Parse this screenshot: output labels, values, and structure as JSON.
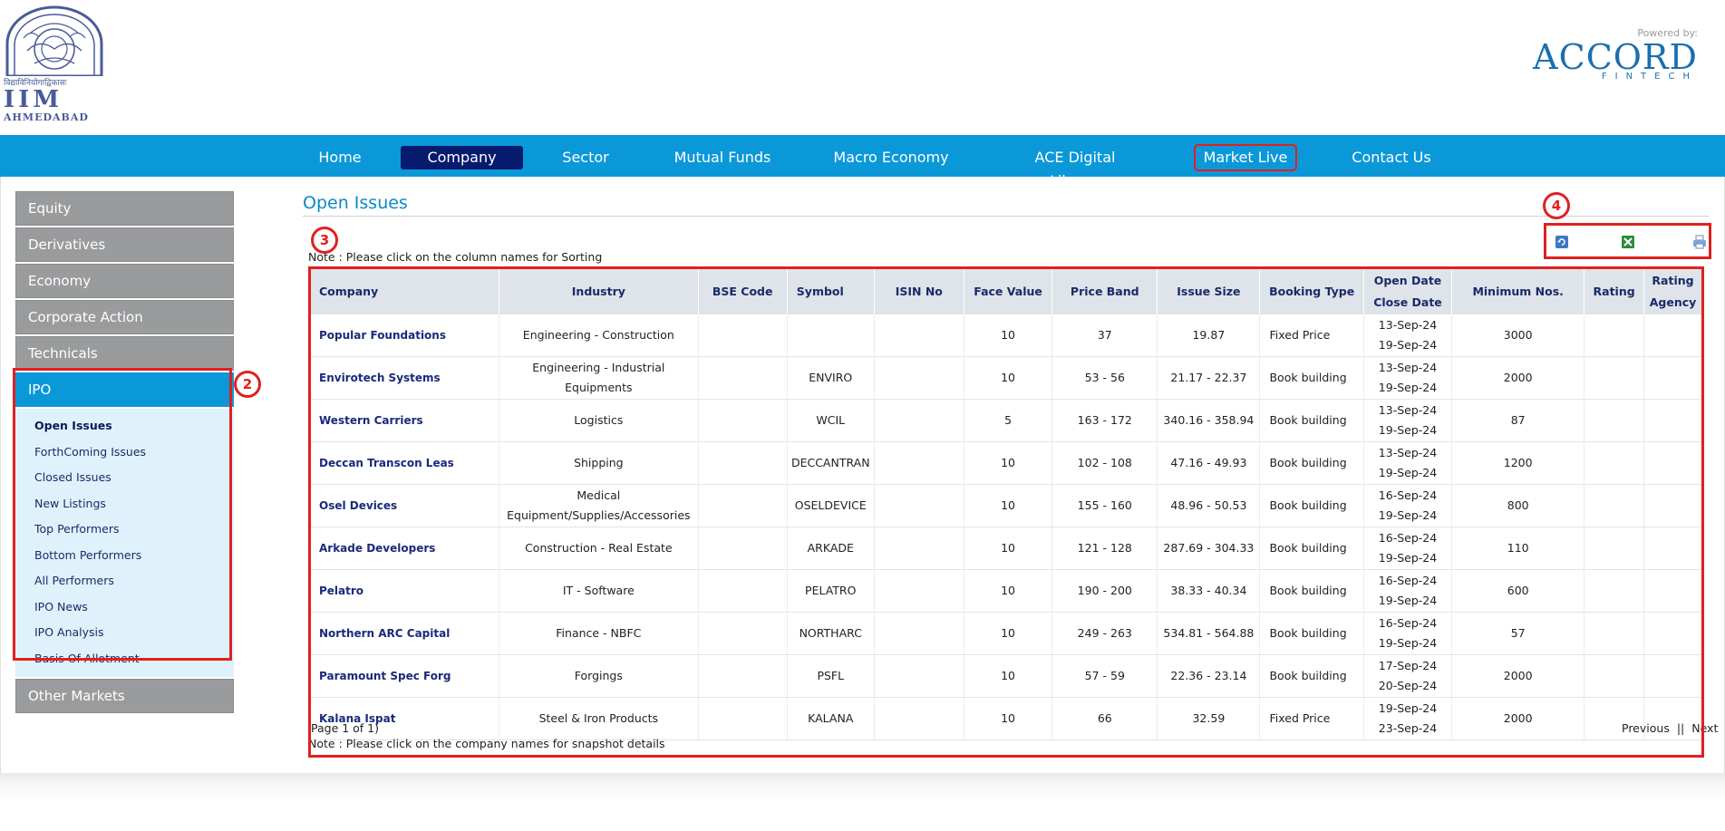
{
  "header": {
    "logo": {
      "hindi_line": "विद्याविनियोगाद्विकासः",
      "abbr": "IIM",
      "city": "AHMEDABAD"
    },
    "powered_by": {
      "label": "Powered by:",
      "brand": "ACCORD",
      "sub": "FINTECH"
    }
  },
  "nav": {
    "items": [
      {
        "label": "Home"
      },
      {
        "label": "Company"
      },
      {
        "label": "Sector"
      },
      {
        "label": "Mutual Funds"
      },
      {
        "label": "Macro Economy"
      },
      {
        "label": "ACE Digital Library"
      },
      {
        "label": "Market Live"
      },
      {
        "label": "Contact Us"
      }
    ],
    "active": "Company"
  },
  "sidebar": {
    "items": [
      {
        "label": "Equity"
      },
      {
        "label": "Derivatives"
      },
      {
        "label": "Economy"
      },
      {
        "label": "Corporate Action"
      },
      {
        "label": "Technicals"
      },
      {
        "label": "IPO"
      }
    ],
    "ipo_submenu": [
      {
        "label": "Open Issues"
      },
      {
        "label": "ForthComing Issues"
      },
      {
        "label": "Closed Issues"
      },
      {
        "label": "New Listings"
      },
      {
        "label": "Top Performers"
      },
      {
        "label": "Bottom Performers"
      },
      {
        "label": "All Performers"
      },
      {
        "label": "IPO News"
      },
      {
        "label": "IPO Analysis"
      },
      {
        "label": "Basis Of Allotment"
      }
    ],
    "after": {
      "label": "Other Markets"
    }
  },
  "markers": {
    "m2": "2",
    "m3": "3",
    "m4": "4"
  },
  "main": {
    "title": "Open Issues",
    "sort_note": "Note : Please click on the column names for Sorting",
    "snapshot_note": "Note : Please click on the company names for snapshot details",
    "page_info": "Page 1 of 1)",
    "pager": {
      "previous": "Previous",
      "separator": "||",
      "next": "Next"
    },
    "tools": [
      "refresh-icon",
      "excel-icon",
      "print-icon"
    ]
  },
  "table": {
    "headers": {
      "company": "Company",
      "industry": "Industry",
      "bse_code": "BSE Code",
      "symbol": "Symbol",
      "isin": "ISIN No",
      "face_value": "Face Value",
      "price_band": "Price Band",
      "issue_size": "Issue Size",
      "booking_type": "Booking Type",
      "open_date": "Open Date",
      "close_date": "Close Date",
      "minimum_nos": "Minimum Nos.",
      "rating": "Rating",
      "rating_agency_1": "Rating",
      "rating_agency_2": "Agency"
    },
    "rows": [
      {
        "company": "Popular Foundations",
        "industry": "Engineering - Construction",
        "bse_code": "",
        "symbol": "",
        "isin": "",
        "face_value": "10",
        "price_band": "37",
        "issue_size": "19.87",
        "booking_type": "Fixed Price",
        "open_date": "13-Sep-24",
        "close_date": "19-Sep-24",
        "minimum_nos": "3000",
        "rating": "",
        "rating_agency": ""
      },
      {
        "company": "Envirotech Systems",
        "industry": "Engineering - Industrial Equipments",
        "bse_code": "",
        "symbol": "ENVIRO",
        "isin": "",
        "face_value": "10",
        "price_band": "53 - 56",
        "issue_size": "21.17 - 22.37",
        "booking_type": "Book building",
        "open_date": "13-Sep-24",
        "close_date": "19-Sep-24",
        "minimum_nos": "2000",
        "rating": "",
        "rating_agency": ""
      },
      {
        "company": "Western Carriers",
        "industry": "Logistics",
        "bse_code": "",
        "symbol": "WCIL",
        "isin": "",
        "face_value": "5",
        "price_band": "163 - 172",
        "issue_size": "340.16 - 358.94",
        "booking_type": "Book building",
        "open_date": "13-Sep-24",
        "close_date": "19-Sep-24",
        "minimum_nos": "87",
        "rating": "",
        "rating_agency": ""
      },
      {
        "company": "Deccan Transcon Leas",
        "industry": "Shipping",
        "bse_code": "",
        "symbol": "DECCANTRAN",
        "isin": "",
        "face_value": "10",
        "price_band": "102 - 108",
        "issue_size": "47.16 - 49.93",
        "booking_type": "Book building",
        "open_date": "13-Sep-24",
        "close_date": "19-Sep-24",
        "minimum_nos": "1200",
        "rating": "",
        "rating_agency": ""
      },
      {
        "company": "Osel Devices",
        "industry": "Medical Equipment/Supplies/Accessories",
        "bse_code": "",
        "symbol": "OSELDEVICE",
        "isin": "",
        "face_value": "10",
        "price_band": "155 - 160",
        "issue_size": "48.96 - 50.53",
        "booking_type": "Book building",
        "open_date": "16-Sep-24",
        "close_date": "19-Sep-24",
        "minimum_nos": "800",
        "rating": "",
        "rating_agency": ""
      },
      {
        "company": "Arkade Developers",
        "industry": "Construction - Real Estate",
        "bse_code": "",
        "symbol": "ARKADE",
        "isin": "",
        "face_value": "10",
        "price_band": "121 - 128",
        "issue_size": "287.69 - 304.33",
        "booking_type": "Book building",
        "open_date": "16-Sep-24",
        "close_date": "19-Sep-24",
        "minimum_nos": "110",
        "rating": "",
        "rating_agency": ""
      },
      {
        "company": "Pelatro",
        "industry": "IT - Software",
        "bse_code": "",
        "symbol": "PELATRO",
        "isin": "",
        "face_value": "10",
        "price_band": "190 - 200",
        "issue_size": "38.33 - 40.34",
        "booking_type": "Book building",
        "open_date": "16-Sep-24",
        "close_date": "19-Sep-24",
        "minimum_nos": "600",
        "rating": "",
        "rating_agency": ""
      },
      {
        "company": "Northern ARC Capital",
        "industry": "Finance - NBFC",
        "bse_code": "",
        "symbol": "NORTHARC",
        "isin": "",
        "face_value": "10",
        "price_band": "249 - 263",
        "issue_size": "534.81 - 564.88",
        "booking_type": "Book building",
        "open_date": "16-Sep-24",
        "close_date": "19-Sep-24",
        "minimum_nos": "57",
        "rating": "",
        "rating_agency": ""
      },
      {
        "company": "Paramount Spec Forg",
        "industry": "Forgings",
        "bse_code": "",
        "symbol": "PSFL",
        "isin": "",
        "face_value": "10",
        "price_band": "57 - 59",
        "issue_size": "22.36 - 23.14",
        "booking_type": "Book building",
        "open_date": "17-Sep-24",
        "close_date": "20-Sep-24",
        "minimum_nos": "2000",
        "rating": "",
        "rating_agency": ""
      },
      {
        "company": "Kalana Ispat",
        "industry": "Steel & Iron Products",
        "bse_code": "",
        "symbol": "KALANA",
        "isin": "",
        "face_value": "10",
        "price_band": "66",
        "issue_size": "32.59",
        "booking_type": "Fixed Price",
        "open_date": "19-Sep-24",
        "close_date": "23-Sep-24",
        "minimum_nos": "2000",
        "rating": "",
        "rating_agency": ""
      }
    ]
  },
  "colors": {
    "nav_bar": "#0b98d8",
    "nav_active": "#061a6e",
    "sidebar_item": "#9a9b9d",
    "sidebar_active": "#0b98d8",
    "submenu_bg": "#dff2fc",
    "annotation_red": "#e02020"
  }
}
